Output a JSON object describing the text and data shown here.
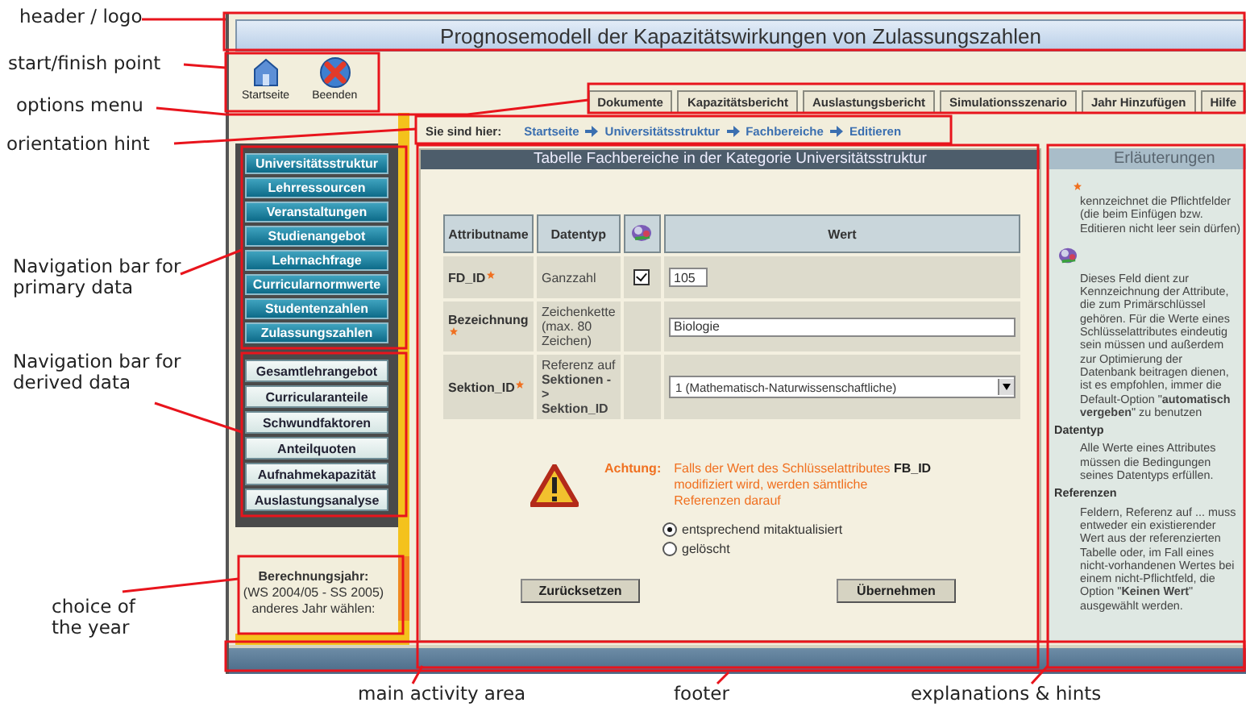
{
  "callouts": [
    {
      "text": "header / logo"
    },
    {
      "text": "start/finish point"
    },
    {
      "text": "options menu"
    },
    {
      "text": "orientation hint"
    },
    {
      "text": "Navigation bar for primary data"
    },
    {
      "text": "Navigation bar for derived data"
    },
    {
      "text": "choice of the year"
    },
    {
      "text": "main activity area"
    },
    {
      "text": "footer"
    },
    {
      "text": "explanations & hints"
    }
  ],
  "header": {
    "title": "Prognosemodell der Kapazitätswirkungen von Zulassungszahlen"
  },
  "start_icons": [
    {
      "kind": "home",
      "label": "Startseite"
    },
    {
      "kind": "exit",
      "label": "Beenden"
    }
  ],
  "options_menu": [
    "Dokumente",
    "Kapazitätsbericht",
    "Auslastungsbericht",
    "Simulationsszenario",
    "Jahr Hinzufügen",
    "Hilfe"
  ],
  "breadcrumb": {
    "label": "Sie sind hier:",
    "items": [
      "Startseite",
      "Universitätsstruktur",
      "Fachbereiche",
      "Editieren"
    ]
  },
  "primary_nav": [
    "Universitätsstruktur",
    "Lehrressourcen",
    "Veranstaltungen",
    "Studienangebot",
    "Lehrnachfrage",
    "Curricularnormwerte",
    "Studentenzahlen",
    "Zulassungszahlen"
  ],
  "derived_nav": [
    "Gesamtlehrangebot",
    "Curricularanteile",
    "Schwundfaktoren",
    "Anteilquoten",
    "Aufnahmekapazität",
    "Auslastungsanalyse"
  ],
  "year": {
    "label": "Berechnungsjahr:",
    "period": "(WS 2004/05 - SS 2005)",
    "change": "anderes Jahr wählen:"
  },
  "main": {
    "title": "Tabelle Fachbereiche in der Kategorie Universitätsstruktur",
    "columns": [
      "Attributname",
      "Datentyp",
      "Wert"
    ],
    "rows": [
      {
        "name": "FD_ID",
        "required": true,
        "type": "Ganzzahl",
        "key_checked": true,
        "kind": "short",
        "value": "105"
      },
      {
        "name": "Bezeichnung",
        "required": true,
        "type": "Zeichenkette (max. 80 Zeichen)",
        "kind": "text",
        "value": "Biologie"
      },
      {
        "name": "Sektion_ID",
        "required": true,
        "type": "Referenz auf **Sektionen -> Sektion_ID**",
        "kind": "select",
        "value": "1 (Mathematisch-Naturwissenschaftliche)"
      }
    ],
    "warning": {
      "label": "Achtung:",
      "text": "Falls der Wert des Schlüsselattributes **FB_ID** modifiziert wird, werden sämtliche Referenzen darauf"
    },
    "options": [
      {
        "label": "entsprechend mitaktualisiert",
        "selected": true
      },
      {
        "label": "gelöscht",
        "selected": false
      }
    ],
    "buttons": [
      "Zurücksetzen",
      "Übernehmen"
    ]
  },
  "explanations": {
    "title": "Erläuterungen",
    "entries": [
      {
        "kind": "required",
        "text": "kennzeichnet die Pflichtfelder (die beim Einfügen bzw. Editieren nicht leer sein dürfen)"
      },
      {
        "kind": "key",
        "text": "Dieses Feld dient zur Kennzeichnung der Attribute, die zum Primärschlüssel gehören. Für die Werte eines Schlüsselattributes eindeutig sein müssen und außerdem zur Optimierung der Datenbank beitragen dienen, ist es empfohlen, immer die Default-Option \"**automatisch vergeben**\" zu benutzen"
      },
      {
        "kind": "term",
        "term": "Datentyp",
        "text": "Alle Werte eines Attributes müssen die Bedingungen seines Datentyps erfüllen."
      },
      {
        "kind": "term",
        "term": "Referenzen",
        "text": "Feldern, Referenz auf ... muss entweder ein existierender Wert aus der referenzierten Tabelle oder, im Fall eines nicht-vorhandenen Wertes bei einem nicht-Pflichtfeld, die Option \"**Keinen Wert**\" ausgewählt werden."
      }
    ]
  }
}
